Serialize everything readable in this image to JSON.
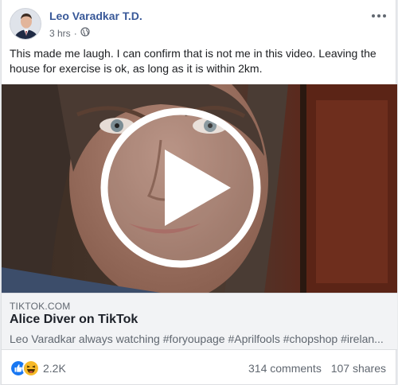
{
  "post": {
    "author": "Leo Varadkar T.D.",
    "time": "3 hrs",
    "separator": "·",
    "text": "This made me laugh. I can confirm that is not me in this video. Leaving the house for exercise is ok, as long as it is within 2km."
  },
  "link": {
    "domain": "TIKTOK.COM",
    "title": "Alice Diver on TikTok",
    "description": "Leo Varadkar always watching #foryoupage #Aprilfools #chopshop #irelan..."
  },
  "footer": {
    "reaction_count": "2.2K",
    "comments": "314 comments",
    "shares": "107 shares"
  },
  "colors": {
    "author_link": "#385898",
    "like_blue": "#1877f2",
    "haha_yellow": "#f7b928"
  }
}
